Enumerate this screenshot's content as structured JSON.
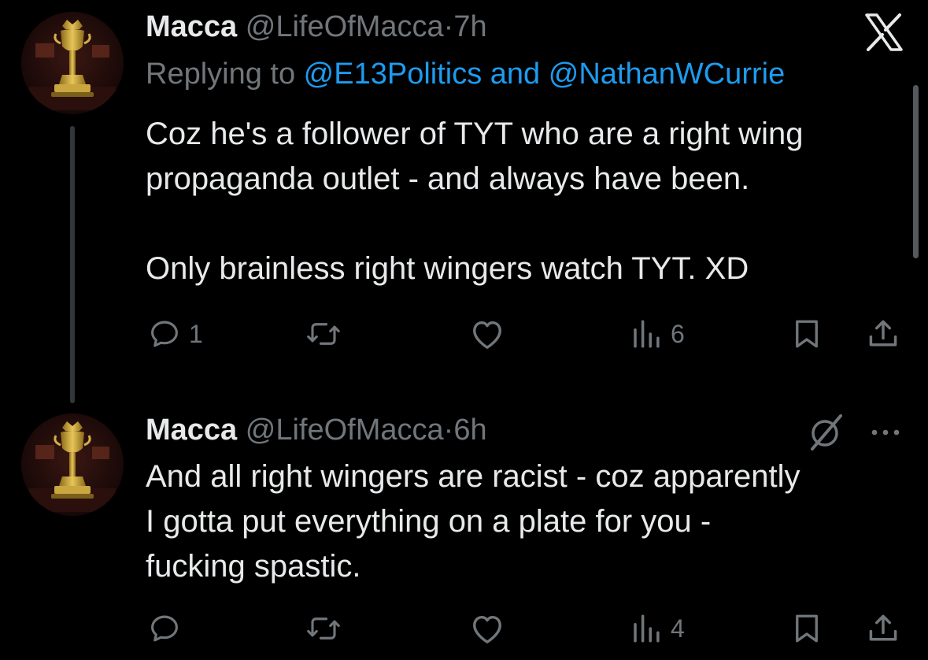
{
  "tweets": [
    {
      "display_name": "Macca",
      "handle": "@LifeOfMacca",
      "separator": "·",
      "time": "7h",
      "reply_prefix": "Replying to ",
      "reply_mention_1": "@E13Politics",
      "reply_and": " and ",
      "reply_mention_2": "@NathanWCurrie",
      "text": "Coz he's a follower of TYT who are a right wing\npropaganda outlet - and always have been.\n\nOnly brainless right wingers watch TYT. XD",
      "replies": "1",
      "reposts": "",
      "likes": "",
      "views": "6"
    },
    {
      "display_name": "Macca",
      "handle": "@LifeOfMacca",
      "separator": "·",
      "time": "6h",
      "text": "And all right wingers are racist - coz apparently\nI gotta put everything on a plate for you -\nfucking spastic.",
      "replies": "",
      "reposts": "",
      "likes": "",
      "views": "4"
    }
  ],
  "icons": {
    "brand": "x-logo-icon",
    "reply": "reply-icon",
    "repost": "repost-icon",
    "like": "like-icon",
    "views": "views-icon",
    "bookmark": "bookmark-icon",
    "share": "share-icon",
    "grok": "grok-icon",
    "more": "more-icon"
  },
  "colors": {
    "background": "#000000",
    "text": "#e7e9ea",
    "muted": "#71767b",
    "link": "#1d9bf0",
    "thread_line": "#333639"
  }
}
